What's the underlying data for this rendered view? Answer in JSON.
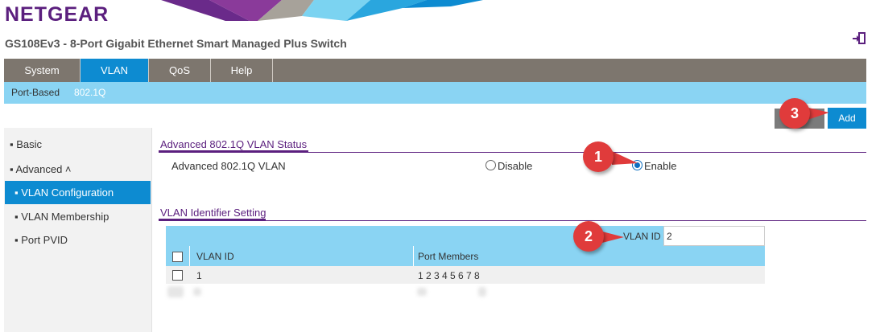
{
  "brand": {
    "logo": "NETGEAR"
  },
  "header": {
    "product_title": "GS108Ev3 - 8-Port Gigabit Ethernet Smart Managed Plus Switch",
    "logout_icon": "logout-icon"
  },
  "main_nav": {
    "tabs": [
      {
        "label": "System",
        "active": false
      },
      {
        "label": "VLAN",
        "active": true
      },
      {
        "label": "QoS",
        "active": false
      },
      {
        "label": "Help",
        "active": false
      }
    ]
  },
  "sub_nav": {
    "tabs": [
      {
        "label": "Port-Based",
        "active": false
      },
      {
        "label": "802.1Q",
        "active": true
      }
    ]
  },
  "toolbar": {
    "add_label": "Add"
  },
  "sidebar": {
    "basic": "▪ Basic",
    "advanced": "▪ Advanced ˄",
    "items": [
      {
        "label": "▪ VLAN Configuration",
        "active": true
      },
      {
        "label": "▪ VLAN Membership",
        "active": false
      },
      {
        "label": "▪ Port PVID",
        "active": false
      }
    ]
  },
  "status_section": {
    "title": "Advanced 802.1Q VLAN Status",
    "field_label": "Advanced 802.1Q VLAN",
    "option_disable": "Disable",
    "option_enable": "Enable",
    "selected": "Enable"
  },
  "identifier_section": {
    "title": "VLAN Identifier Setting",
    "vlan_id_label": "VLAN ID",
    "vlan_id_value": "2"
  },
  "table": {
    "columns": [
      "VLAN ID",
      "Port Members"
    ],
    "rows": [
      {
        "vlan_id": "1",
        "port_members": "1 2 3 4 5 6 7 8"
      }
    ]
  },
  "callouts": [
    "1",
    "2",
    "3"
  ],
  "colors": {
    "brand_purple": "#5b1f7e",
    "nav_gray": "#7d766e",
    "accent_blue": "#0d8bd1",
    "light_blue": "#8ad4f3",
    "callout_red": "#e03b3b"
  }
}
